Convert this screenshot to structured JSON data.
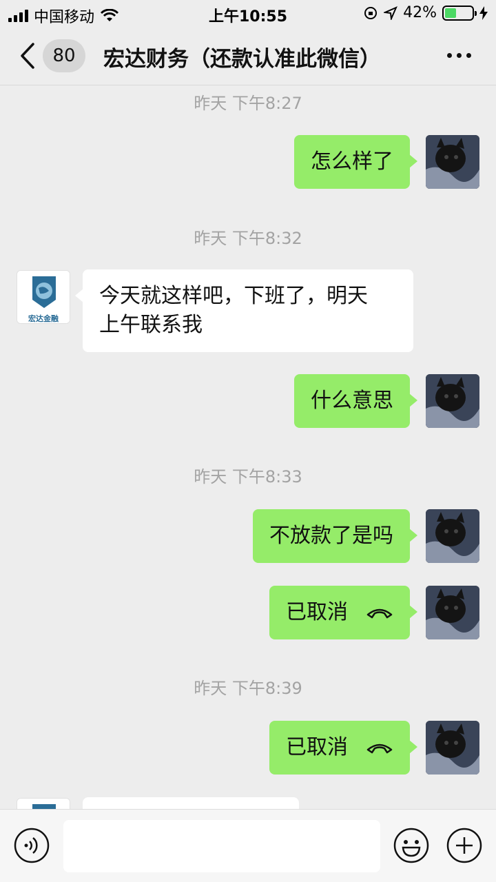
{
  "status": {
    "carrier": "中国移动",
    "time": "上午10:55",
    "battery": "42%",
    "battery_level": 0.42
  },
  "nav": {
    "unread_count": "80",
    "title": "宏达财务（还款认准此微信）"
  },
  "avatars": {
    "contact_logo_text": "宏达金融"
  },
  "messages": {
    "ts1": "昨天 下午8:27",
    "m1": "怎么样了",
    "ts2": "昨天 下午8:32",
    "m2_line1": "今天就这样吧，下班了，明天",
    "m2_line2": "上午联系我",
    "m3": "什么意思",
    "ts3": "昨天 下午8:33",
    "m4": "不放款了是吗",
    "m5": "已取消",
    "ts4": "昨天 下午8:39",
    "m6": "已取消"
  },
  "colors": {
    "my_bubble": "#95ec69",
    "their_bubble": "#ffffff",
    "background": "#ededed"
  }
}
